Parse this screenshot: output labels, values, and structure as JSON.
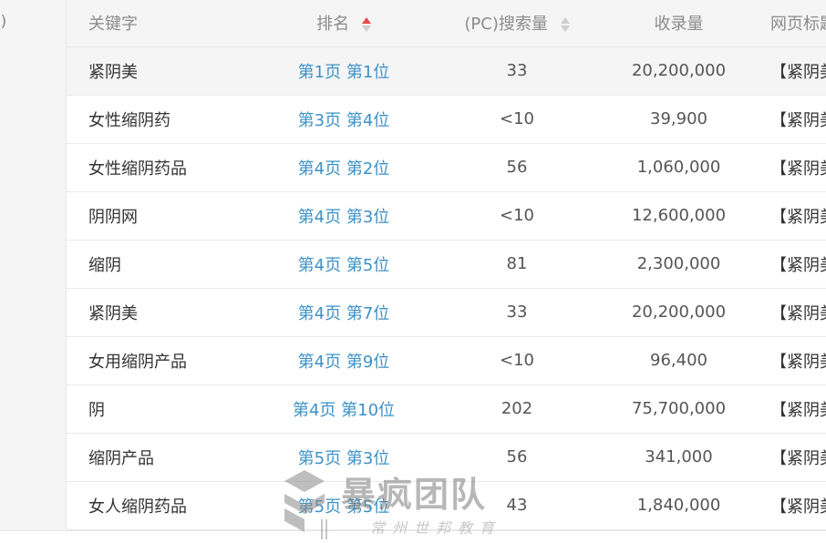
{
  "left_panel": {
    "cut_label": "() "
  },
  "table": {
    "headers": {
      "keyword": "关键字",
      "rank": "排名",
      "search_volume": "(PC)搜索量",
      "indexed": "收录量",
      "page_title": "网页标题"
    },
    "rows": [
      {
        "keyword": "紧阴美",
        "rank": "第1页 第1位",
        "search": "33",
        "indexed": "20,200,000",
        "title": "【紧阴美"
      },
      {
        "keyword": "女性缩阴药",
        "rank": "第3页 第4位",
        "search": "<10",
        "indexed": "39,900",
        "title": "【紧阴美"
      },
      {
        "keyword": "女性缩阴药品",
        "rank": "第4页 第2位",
        "search": "56",
        "indexed": "1,060,000",
        "title": "【紧阴美"
      },
      {
        "keyword": "阴阴网",
        "rank": "第4页 第3位",
        "search": "<10",
        "indexed": "12,600,000",
        "title": "【紧阴美"
      },
      {
        "keyword": "缩阴",
        "rank": "第4页 第5位",
        "search": "81",
        "indexed": "2,300,000",
        "title": "【紧阴美"
      },
      {
        "keyword": "紧阴美",
        "rank": "第4页 第7位",
        "search": "33",
        "indexed": "20,200,000",
        "title": "【紧阴美"
      },
      {
        "keyword": "女用缩阴产品",
        "rank": "第4页 第9位",
        "search": "<10",
        "indexed": "96,400",
        "title": "【紧阴美"
      },
      {
        "keyword": "阴",
        "rank": "第4页 第10位",
        "search": "202",
        "indexed": "75,700,000",
        "title": "【紧阴美"
      },
      {
        "keyword": "缩阴产品",
        "rank": "第5页 第3位",
        "search": "56",
        "indexed": "341,000",
        "title": "【紧阴美"
      },
      {
        "keyword": "女人缩阴药品",
        "rank": "第5页 第5位",
        "search": "43",
        "indexed": "1,840,000",
        "title": "【紧阴美"
      }
    ]
  },
  "watermark": {
    "main": "暴疯团队",
    "sub": "常州世邦教育"
  },
  "colors": {
    "rank_link": "#3a92c8",
    "sort_active": "#e84b4b",
    "header_bg": "#f5f5f5"
  },
  "icons": {
    "rank_sort": "sort-asc-icon",
    "search_sort": "sort-icon"
  }
}
